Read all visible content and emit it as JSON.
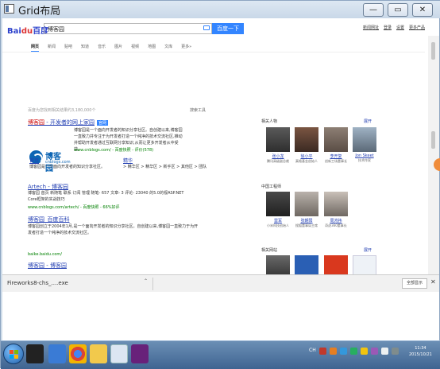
{
  "window": {
    "title": "Grid布局",
    "min_label": "—",
    "max_label": "▭",
    "close_label": "✕"
  },
  "search": {
    "logo_a": "Bai",
    "logo_paw": "du",
    "logo_b": "百度",
    "query": "博客园",
    "button": "百度一下"
  },
  "top_links": [
    "新闻网址",
    "登录",
    "设置",
    "更多产品"
  ],
  "tabs": [
    {
      "label": "网页",
      "active": true
    },
    {
      "label": "新闻"
    },
    {
      "label": "贴吧"
    },
    {
      "label": "知道"
    },
    {
      "label": "音乐"
    },
    {
      "label": "图片"
    },
    {
      "label": "视频"
    },
    {
      "label": "地图"
    },
    {
      "label": "文库"
    },
    {
      "label": "更多»"
    }
  ],
  "results_info": "百度为您找到相关结果约3,180,000个",
  "tools_label": "搜索工具",
  "results": [
    {
      "title_hl": "博客园",
      "title_rest": " - 开发者的网上家园",
      "badge": "官网",
      "snippet": "博客园是一个面向开发者的知识分享社区。自创建以来,博客园一直致力并专注于为开发者打造一个纯净的技术交流社区,推动并帮助开发者通过互联网分享知识,从而让更多开发者从中受益。",
      "url": "www.cnblogs.com/ - 百度快照 - 评价(578)",
      "sub_left_title": "首页",
      "sub_left_text": "博客园是一个面向开发者的知识分享社区。",
      "sub_right_title": "精华",
      "sub_right_text": "> 精华区 > 精华区 > 新手区 > 其他区 > 团队"
    },
    {
      "title": "Artech - 博客园",
      "snippet": "博客园 首页 新随笔 联系 订阅 管理 随笔- 657 文章- 3 评论- 23040 的5.0的视ASP.NET Core框架的实战技巧",
      "url": "www.cnblogs.com/artech/ - 百度快照 - 66%好评"
    },
    {
      "title": "博客园_百度百科",
      "snippet": "博客园创立于2004年1月,是一个面向开发者的知识分享社区。自创建以来,博客园一直致力于为开发者打造一个纯净的技术交流社区。",
      "url": "baike.baidu.com/"
    },
    {
      "title": "博客园 - 博客园"
    }
  ],
  "sidebar": {
    "related_people_title": "相关人物",
    "engineers_title": "中国工程师",
    "websites_title": "相关网站",
    "expand_label": "展开",
    "people": [
      {
        "name": "张小龙",
        "desc": "腾讯高级副总裁"
      },
      {
        "name": "徐小平",
        "desc": "真格基金创始人"
      },
      {
        "name": "李开复",
        "desc": "创新工场董事长"
      },
      {
        "name": "Jon Skeet",
        "desc": "技术作家"
      }
    ],
    "engineers": [
      {
        "name": "雷军",
        "desc": "小米科技创始人"
      },
      {
        "name": "张朝阳",
        "desc": "搜狐董事局主席"
      },
      {
        "name": "周鸿祎",
        "desc": "奇虎360董事长"
      }
    ]
  },
  "download": {
    "file": "Fireworks8-chs_....exe",
    "show_all": "全部显示"
  },
  "taskbar": {
    "clock_time": "11:34",
    "clock_date": "2015/10/21",
    "lang": "CH"
  }
}
